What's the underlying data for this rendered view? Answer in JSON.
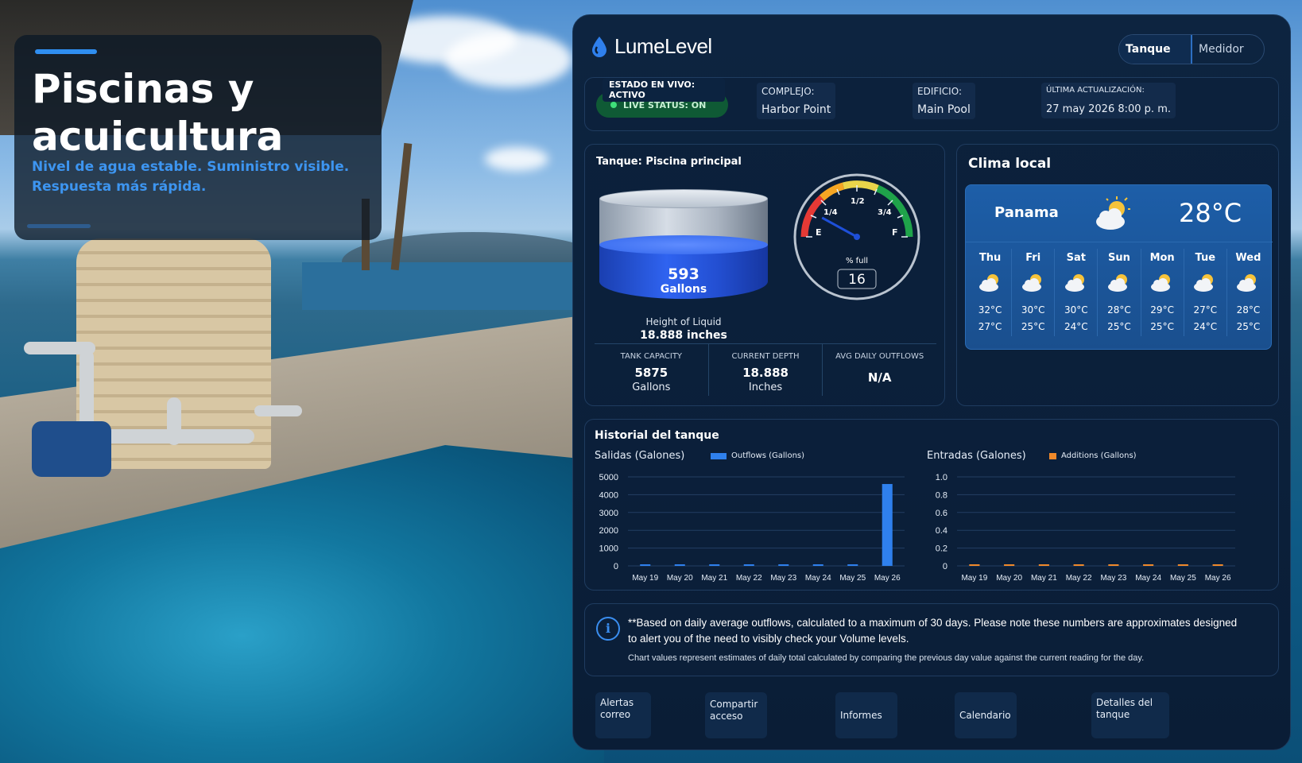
{
  "hero": {
    "title": "Piscinas y acuicultura",
    "subtitle": "Nivel de agua estable. Suministro visible. Respuesta más rápida."
  },
  "app": {
    "brand": "LumeLevel",
    "toggle": {
      "active": "Tanque",
      "inactive": "Medidor"
    }
  },
  "status": {
    "live_tag": "ESTADO EN VIVO: ACTIVO",
    "live_pill": "LIVE STATUS: ON",
    "complex_label": "COMPLEJO:",
    "complex_value": "Harbor Point",
    "building_label": "EDIFICIO:",
    "building_value": "Main Pool",
    "updated_label": "ÚLTIMA ACTUALIZACIÓN:",
    "updated_value": "27 may 2026 8:00 p. m."
  },
  "tank": {
    "title": "Tanque: Piscina principal",
    "gallons": "593",
    "gallons_label": "Gallons",
    "height_label": "Height of Liquid",
    "height_value": "18.888 inches",
    "gauge_labels": {
      "e": "E",
      "q1": "1/4",
      "half": "1/2",
      "q3": "3/4",
      "f": "F"
    },
    "percent_label": "% full",
    "percent_full": "16",
    "stats": [
      {
        "label": "TANK CAPACITY",
        "value": "5875",
        "unit": "Gallons"
      },
      {
        "label": "CURRENT DEPTH",
        "value": "18.888",
        "unit": "Inches"
      },
      {
        "label": "AVG DAILY OUTFLOWS",
        "value": "N/A",
        "unit": ""
      }
    ]
  },
  "weather": {
    "title": "Clima local",
    "city": "Panama",
    "temp": "28°C",
    "icon": "partly-cloudy-icon",
    "days": [
      {
        "name": "Thu",
        "hi": "32°C",
        "lo": "27°C"
      },
      {
        "name": "Fri",
        "hi": "30°C",
        "lo": "25°C"
      },
      {
        "name": "Sat",
        "hi": "30°C",
        "lo": "24°C"
      },
      {
        "name": "Sun",
        "hi": "28°C",
        "lo": "25°C"
      },
      {
        "name": "Mon",
        "hi": "29°C",
        "lo": "25°C"
      },
      {
        "name": "Tue",
        "hi": "27°C",
        "lo": "24°C"
      },
      {
        "name": "Wed",
        "hi": "28°C",
        "lo": "25°C"
      }
    ]
  },
  "history": {
    "title": "Historial del tanque"
  },
  "chart_data": [
    {
      "type": "bar",
      "title": "Salidas (Galones)",
      "categories": [
        "May 19",
        "May 20",
        "May 21",
        "May 22",
        "May 23",
        "May 24",
        "May 25",
        "May 26"
      ],
      "series": [
        {
          "name": "Outflows (Gallons)",
          "values": [
            40,
            30,
            20,
            20,
            20,
            20,
            20,
            4600
          ],
          "color": "#2f80ed"
        }
      ],
      "yticks": [
        "0",
        "1000",
        "2000",
        "3000",
        "4000",
        "5000"
      ],
      "ylim": [
        0,
        5000
      ],
      "grid": true,
      "legend": "top"
    },
    {
      "type": "bar",
      "title": "Entradas (Galones)",
      "categories": [
        "May 19",
        "May 20",
        "May 21",
        "May 22",
        "May 23",
        "May 24",
        "May 25",
        "May 26"
      ],
      "series": [
        {
          "name": "Additions (Gallons)",
          "values": [
            0,
            0,
            0,
            0,
            0,
            0,
            0,
            0
          ],
          "color": "#f0892a"
        }
      ],
      "yticks": [
        "0",
        "0.2",
        "0.4",
        "0.6",
        "0.8",
        "1.0"
      ],
      "ylim": [
        0,
        1.0
      ],
      "grid": true,
      "legend": "top"
    }
  ],
  "note": {
    "text": "**Based on daily average outflows, calculated to a maximum of 30 days. Please note these numbers are approximates designed to alert you of the need to visibly check your Volume levels.",
    "small": "Chart values represent estimates of daily total calculated by comparing the previous day value against the current reading for the day."
  },
  "nav": [
    "Alertas correo",
    "Compartir acceso",
    "Informes",
    "Calendario",
    "Detalles del tanque"
  ]
}
